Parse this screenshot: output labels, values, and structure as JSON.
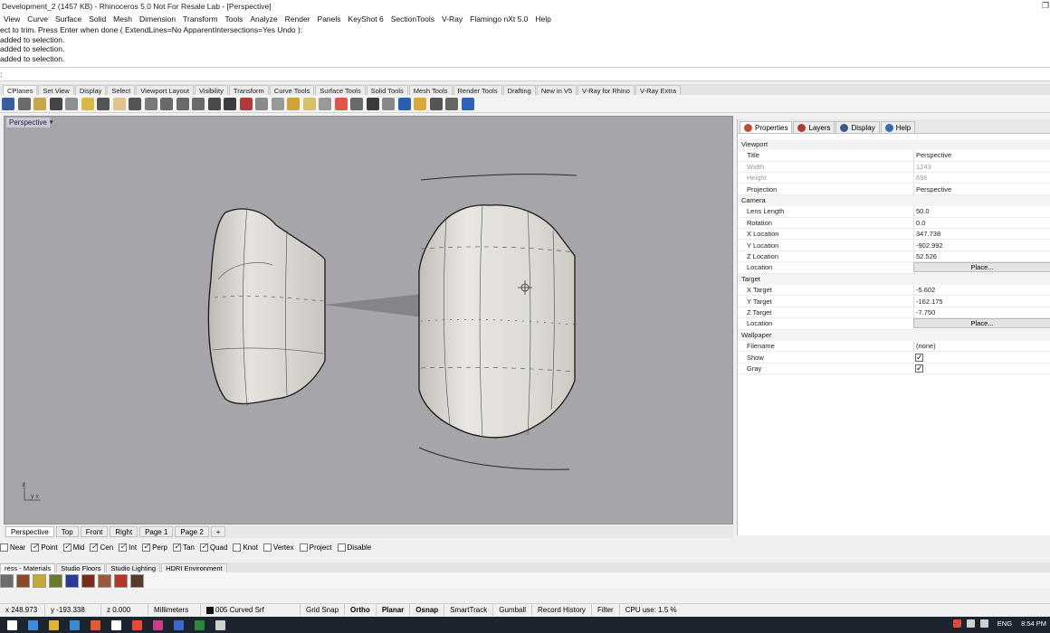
{
  "window": {
    "title": "Development_2 (1457 KB) - Rhinoceros 5.0 Not For Resale Lab - [Perspective]",
    "restore_glyph": "❐"
  },
  "menu": [
    "View",
    "Curve",
    "Surface",
    "Solid",
    "Mesh",
    "Dimension",
    "Transform",
    "Tools",
    "Analyze",
    "Render",
    "Panels",
    "KeyShot 6",
    "SectionTools",
    "V-Ray",
    "Flamingo nXt 5.0",
    "Help"
  ],
  "command_history": [
    "ect to trim. Press Enter when done ( ExtendLines=No  ApparentIntersections=Yes  Undo ):",
    "added to selection.",
    "added to selection.",
    "added to selection."
  ],
  "command_prompt": ":",
  "toolbar_tabs": [
    "CPlanes",
    "Set View",
    "Display",
    "Select",
    "Viewport Layout",
    "Visibility",
    "Transform",
    "Curve Tools",
    "Surface Tools",
    "Solid Tools",
    "Mesh Tools",
    "Render Tools",
    "Drafting",
    "New in V5",
    "V-Ray for Rhino",
    "V-Ray Extra"
  ],
  "toolbar_icons": [
    {
      "name": "save-icon",
      "color": "#3a5f9e"
    },
    {
      "name": "print-icon",
      "color": "#6b6b6b"
    },
    {
      "name": "copy-icon",
      "color": "#c8a64a"
    },
    {
      "name": "cut-icon",
      "color": "#444444"
    },
    {
      "name": "paste-icon",
      "color": "#8f8f8f"
    },
    {
      "name": "clipboard-icon",
      "color": "#d9b84a"
    },
    {
      "name": "undo-icon",
      "color": "#555555"
    },
    {
      "name": "pan-icon",
      "color": "#e0c38a"
    },
    {
      "name": "move-icon",
      "color": "#555555"
    },
    {
      "name": "zoom-icon",
      "color": "#7a7a7a"
    },
    {
      "name": "zoom-window-icon",
      "color": "#6a6a6a"
    },
    {
      "name": "zoom-extents-icon",
      "color": "#6a6a6a"
    },
    {
      "name": "zoom-selected-icon",
      "color": "#6a6a6a"
    },
    {
      "name": "rotate-view-icon",
      "color": "#4a4a4a"
    },
    {
      "name": "viewport-layout-icon",
      "color": "#3d3d3d"
    },
    {
      "name": "car-icon",
      "color": "#b03a3a"
    },
    {
      "name": "pencil-icon",
      "color": "#8a8a8a"
    },
    {
      "name": "snap-icon",
      "color": "#999999"
    },
    {
      "name": "select-icon",
      "color": "#cfa23a"
    },
    {
      "name": "light-bulb-icon",
      "color": "#d6c06a"
    },
    {
      "name": "lock-icon",
      "color": "#999999"
    },
    {
      "name": "render-color-icon",
      "color": "#e0574a"
    },
    {
      "name": "sphere-wire-icon",
      "color": "#6a6a6a"
    },
    {
      "name": "sphere-shade-icon",
      "color": "#3a3a3a"
    },
    {
      "name": "sphere-render-icon",
      "color": "#888888"
    },
    {
      "name": "globe-icon",
      "color": "#2b5fb0"
    },
    {
      "name": "brush-icon",
      "color": "#d9a93a"
    },
    {
      "name": "options-icon",
      "color": "#555555"
    },
    {
      "name": "transform-icon",
      "color": "#666666"
    },
    {
      "name": "help-icon",
      "color": "#2f62b8"
    }
  ],
  "viewport": {
    "label": "Perspective",
    "dropdown_glyph": "▾",
    "axis_z": "z",
    "axis_xy": "y x",
    "background": "#a6a6aa"
  },
  "viewport_tabs": [
    "Perspective",
    "Top",
    "Front",
    "Right",
    "Page 1",
    "Page 2",
    "+"
  ],
  "osnaps": [
    {
      "label": "Near",
      "checked": false
    },
    {
      "label": "Point",
      "checked": true
    },
    {
      "label": "Mid",
      "checked": true
    },
    {
      "label": "Cen",
      "checked": true
    },
    {
      "label": "Int",
      "checked": true
    },
    {
      "label": "Perp",
      "checked": true
    },
    {
      "label": "Tan",
      "checked": true
    },
    {
      "label": "Quad",
      "checked": true
    },
    {
      "label": "Knot",
      "checked": false
    },
    {
      "label": "Vertex",
      "checked": false
    },
    {
      "label": "Project",
      "checked": false
    },
    {
      "label": "Disable",
      "checked": false
    }
  ],
  "material_tabs": [
    "ress - Materials",
    "Studio Floors",
    "Studio Lighting",
    "HDRI Environment"
  ],
  "material_swatches": [
    "#6c6c6c",
    "#8a4a2a",
    "#c8a63a",
    "#6a7a2a",
    "#2a3a9a",
    "#7a2a1a",
    "#9a5a3a",
    "#b03a2a",
    "#5a3a2a"
  ],
  "status": {
    "x": "x 248.973",
    "y": "y -193.338",
    "z": "z 0.000",
    "units": "Millimeters",
    "layer": "005 Curved Srf",
    "grid_snap": "Grid Snap",
    "ortho": "Ortho",
    "planar": "Planar",
    "osnap": "Osnap",
    "smarttrack": "SmartTrack",
    "gumball": "Gumball",
    "record_history": "Record History",
    "filter": "Filter",
    "cpu": "CPU use: 1.5 %"
  },
  "panel": {
    "tabs": [
      {
        "label": "Properties",
        "color": "#c24a3a"
      },
      {
        "label": "Layers",
        "color": "#b03a3a"
      },
      {
        "label": "Display",
        "color": "#3a5a8a"
      },
      {
        "label": "Help",
        "color": "#3a6ab0"
      }
    ],
    "sections": {
      "viewport": "Viewport",
      "camera": "Camera",
      "target": "Target",
      "wallpaper": "Wallpaper"
    },
    "viewport_rows": [
      {
        "key": "Title",
        "value": "Perspective",
        "dim": false
      },
      {
        "key": "Width",
        "value": "1243",
        "dim": true
      },
      {
        "key": "Height",
        "value": "696",
        "dim": true
      },
      {
        "key": "Projection",
        "value": "Perspective",
        "dim": false
      }
    ],
    "camera_rows": [
      {
        "key": "Lens Length",
        "value": "50.0"
      },
      {
        "key": "Rotation",
        "value": "0.0"
      },
      {
        "key": "X Location",
        "value": "347.738"
      },
      {
        "key": "Y Location",
        "value": "-902.992"
      },
      {
        "key": "Z Location",
        "value": "52.526"
      }
    ],
    "camera_location": {
      "key": "Location",
      "button": "Place..."
    },
    "target_rows": [
      {
        "key": "X Target",
        "value": "-5.602"
      },
      {
        "key": "Y Target",
        "value": "-162.175"
      },
      {
        "key": "Z Target",
        "value": "-7.750"
      }
    ],
    "target_location": {
      "key": "Location",
      "button": "Place..."
    },
    "wallpaper_rows": [
      {
        "key": "Filename",
        "value": "(none)"
      },
      {
        "key": "Show",
        "checked": true
      },
      {
        "key": "Gray",
        "checked": true
      }
    ]
  },
  "taskbar": {
    "icons": [
      "#ffffff",
      "#3b8fe0",
      "#e0b13a",
      "#3a8ad0",
      "#e05a3a",
      "#ffffff",
      "#e84a3a",
      "#d23a8a",
      "#3a6ad0",
      "#2a8a3a",
      "#d0d0d0"
    ],
    "tray_lang": "ENG",
    "time": "8:54 PM"
  }
}
